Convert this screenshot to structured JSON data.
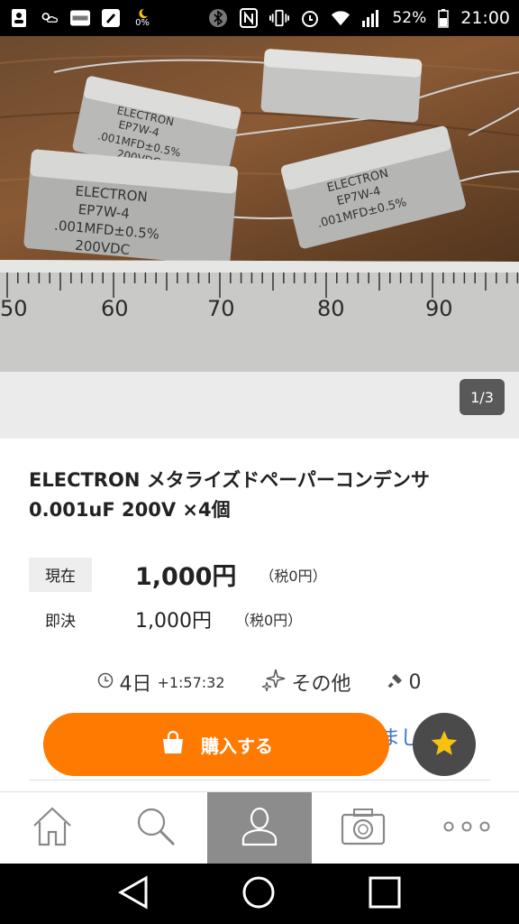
{
  "status_bar": {
    "battery_percent": "52%",
    "clock": "21:00",
    "night_battery": "0%",
    "icons_left": [
      "contacts-icon",
      "weather-icon",
      "yahuoku-app-icon",
      "app-icon",
      "moon-icon"
    ],
    "icons_right": [
      "bluetooth-icon",
      "nfc-icon",
      "vibrate-icon",
      "alarm-icon",
      "wifi-icon",
      "signal-icon",
      "battery-icon"
    ]
  },
  "gallery": {
    "page_indicator": "1/3",
    "photo_markings": {
      "cap_brand": "ELECTRON",
      "cap_model": "EP7W-4",
      "cap_value": ".001MFD±0.5%",
      "cap_voltage": "200VDC",
      "ruler_numbers": [
        "50",
        "60",
        "70",
        "80",
        "90"
      ]
    }
  },
  "item": {
    "title": "ELECTRON メタライズドペーパーコンデンサ 0.001uF 200V ×4個",
    "current_label": "現在",
    "current_price": "1,000円",
    "current_tax": "（税0円）",
    "buyout_label": "即決",
    "buyout_price": "1,000円",
    "buyout_tax": "（税0円）"
  },
  "meta": {
    "time_days": "4日",
    "time_rest": "+1:57:32",
    "condition": "その他",
    "bids": "0"
  },
  "actions": {
    "buy_label": "購入する",
    "partial_text": "まし"
  },
  "nav": {
    "items": [
      "home-icon",
      "search-icon",
      "user-icon",
      "camera-icon",
      "more-icon"
    ],
    "active_index": 2
  },
  "colors": {
    "accent": "#ff7a00",
    "fab": "#4a4a4a",
    "star": "#f5c211",
    "nav_active": "#8c8c8c"
  }
}
